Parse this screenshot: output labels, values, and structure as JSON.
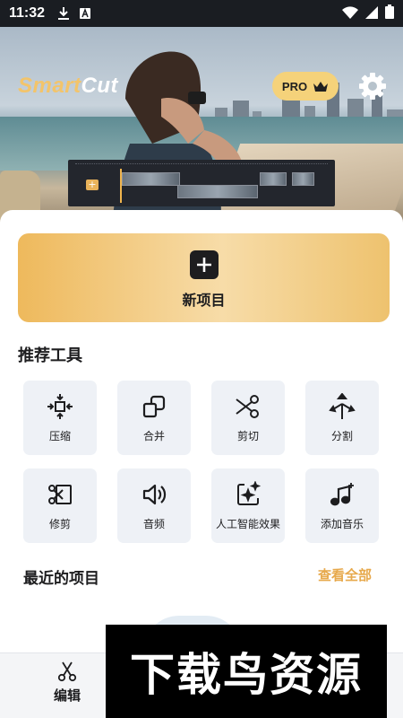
{
  "status_bar": {
    "time": "11:32",
    "icons": [
      "download-icon",
      "a-notification-icon",
      "wifi-icon",
      "cell-signal-icon",
      "battery-icon"
    ]
  },
  "header": {
    "logo_part1": "Smart",
    "logo_part2": "Cut",
    "pro_label": "PRO",
    "pro_icon": "crown-icon",
    "settings_icon": "gear-icon"
  },
  "new_project": {
    "label": "新项目",
    "icon": "plus-icon"
  },
  "tools": {
    "title": "推荐工具",
    "items": [
      {
        "label": "压缩",
        "icon": "compress-icon"
      },
      {
        "label": "合并",
        "icon": "merge-icon"
      },
      {
        "label": "剪切",
        "icon": "scissors-icon"
      },
      {
        "label": "分割",
        "icon": "split-icon"
      },
      {
        "label": "修剪",
        "icon": "trim-icon"
      },
      {
        "label": "音频",
        "icon": "volume-icon"
      },
      {
        "label": "人工智能效果",
        "icon": "ai-sparkle-icon"
      },
      {
        "label": "添加音乐",
        "icon": "music-add-icon"
      }
    ]
  },
  "recent": {
    "title": "最近的项目",
    "view_all": "查看全部"
  },
  "bottom_nav": {
    "edit_label": "编辑",
    "edit_icon": "scissors-icon"
  },
  "watermark": {
    "text": "下载鸟资源"
  },
  "colors": {
    "accent": "#e7a94c",
    "new_project_gradient": [
      "#eeb95c",
      "#f7dca8",
      "#eec26e"
    ],
    "tool_tile_bg": "#eef1f6",
    "pro_badge": "#f5d27a"
  }
}
